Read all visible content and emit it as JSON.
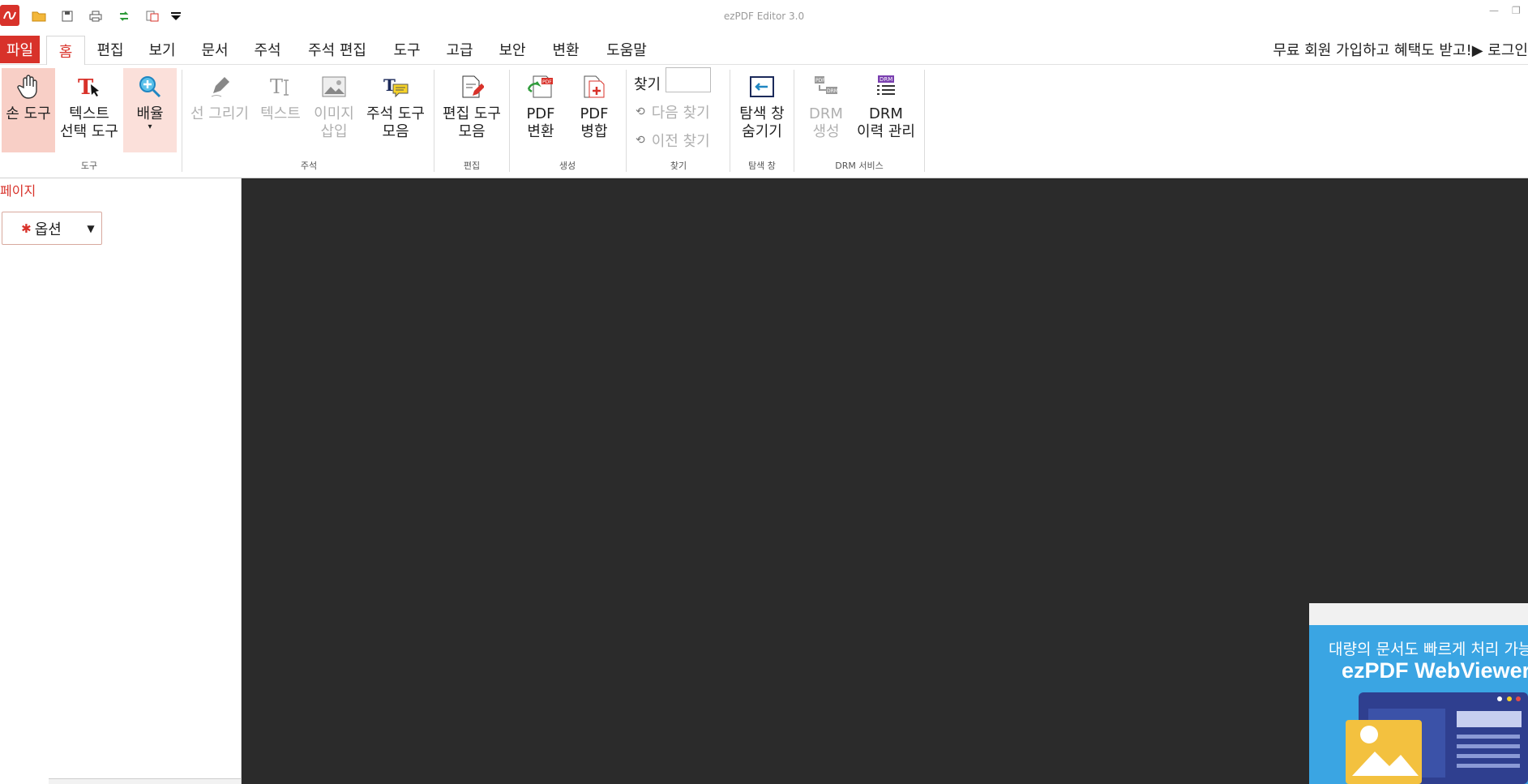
{
  "app": {
    "title": "ezPDF Editor 3.0"
  },
  "quick_access": [
    "open-folder-icon",
    "save-icon",
    "print-icon",
    "refresh-icon",
    "compare-icon",
    "customize-dropdown-icon"
  ],
  "menu": {
    "file": "파일",
    "tabs": [
      "홈",
      "편집",
      "보기",
      "문서",
      "주석",
      "주석 편집",
      "도구",
      "고급",
      "보안",
      "변환",
      "도움말"
    ],
    "active": "홈",
    "promo": "무료 회원 가입하고 혜택도 받고!▶ 로그인"
  },
  "ribbon": {
    "hand": "손 도구",
    "text_select": "텍스트\n선택 도구",
    "zoom": "배율",
    "draw_line": "선 그리기",
    "text": "텍스트",
    "insert_image": "이미지\n삽입",
    "annot_tools": "주석 도구\n모음",
    "edit_tools": "편집 도구\n모음",
    "pdf_convert": "PDF\n변환",
    "pdf_merge": "PDF\n병합",
    "find_label": "찾기",
    "find_value": "",
    "find_next": "다음 찾기",
    "find_prev": "이전 찾기",
    "hide_nav": "탐색 창\n숨기기",
    "drm_create": "DRM\n생성",
    "drm_history": "DRM\n이력 관리",
    "groups": {
      "tools": "도구",
      "annotation": "주석",
      "edit": "편집",
      "create": "생성",
      "find": "찾기",
      "nav": "탐색 창",
      "drm": "DRM 서비스"
    }
  },
  "panel": {
    "title": "페이지",
    "options": "옵션"
  },
  "ad": {
    "headline": "대량의 문서도 빠르게 처리 가능한",
    "product": "ezPDF WebViewer"
  },
  "colors": {
    "accent": "#d8322a",
    "viewer_bg": "#2b2b2b",
    "ad_bg": "#3aa5e3"
  }
}
